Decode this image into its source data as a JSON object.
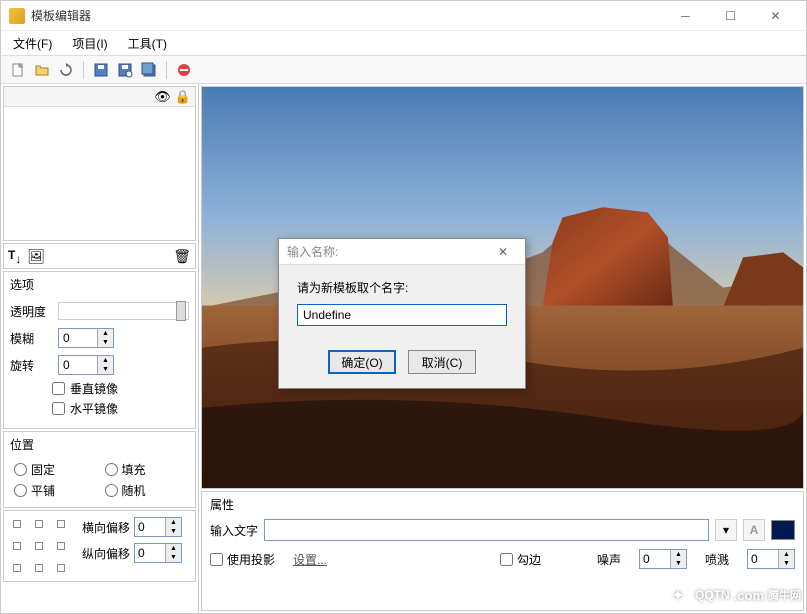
{
  "window": {
    "title": "模板编辑器"
  },
  "menu": {
    "file": "文件(F)",
    "project": "项目(I)",
    "tools": "工具(T)"
  },
  "panel": {
    "options_title": "选项",
    "opacity": "透明度",
    "blur": "模糊",
    "rotate": "旋转",
    "blur_val": "0",
    "rotate_val": "0",
    "flip_v": "垂直镜像",
    "flip_h": "水平镜像",
    "position_title": "位置",
    "fixed": "固定",
    "fill": "填充",
    "tile": "平铺",
    "random": "随机",
    "offset_h": "横向偏移",
    "offset_v": "纵向偏移",
    "offset_h_val": "0",
    "offset_v_val": "0"
  },
  "props": {
    "title": "属性",
    "text_label": "输入文字",
    "shadow": "使用投影",
    "settings": "设置...",
    "stroke": "勾边",
    "noise": "噪声",
    "noise_val": "0",
    "spray": "喷溅",
    "spray_val": "0"
  },
  "dialog": {
    "title": "输入名称:",
    "prompt": "请为新模板取个名字:",
    "value": "Undefine",
    "ok": "确定(O)",
    "cancel": "取消(C)"
  },
  "watermark": {
    "brand": "QQTN",
    "dom": ".com",
    "cn": "腾牛网"
  }
}
